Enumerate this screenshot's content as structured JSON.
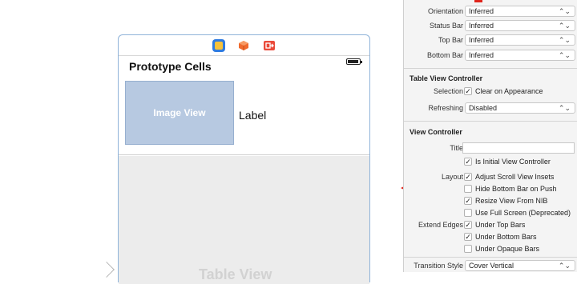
{
  "canvas": {
    "prototype_cells_title": "Prototype Cells",
    "image_view_label": "Image View",
    "cell_label": "Label",
    "table_view_ghost": "Table View",
    "dock_icons": [
      "view-controller-icon",
      "first-responder-icon",
      "exit-icon"
    ]
  },
  "inspector": {
    "simulated_metrics": {
      "rows": [
        {
          "label": "Orientation",
          "value": "Inferred"
        },
        {
          "label": "Status Bar",
          "value": "Inferred"
        },
        {
          "label": "Top Bar",
          "value": "Inferred"
        },
        {
          "label": "Bottom Bar",
          "value": "Inferred"
        }
      ]
    },
    "table_view_controller": {
      "heading": "Table View Controller",
      "selection_label": "Selection",
      "selection_option": "Clear on Appearance",
      "selection_checked": true,
      "refreshing_label": "Refreshing",
      "refreshing_value": "Disabled"
    },
    "view_controller": {
      "heading": "View Controller",
      "title_label": "Title",
      "title_value": "",
      "is_initial_label": "Is Initial View Controller",
      "is_initial_checked": true,
      "layout_label": "Layout",
      "layout_options": [
        {
          "label": "Adjust Scroll View Insets",
          "checked": true
        },
        {
          "label": "Hide Bottom Bar on Push",
          "checked": false
        },
        {
          "label": "Resize View From NIB",
          "checked": true
        },
        {
          "label": "Use Full Screen (Deprecated)",
          "checked": false
        }
      ],
      "extend_edges_label": "Extend Edges",
      "extend_edges_options": [
        {
          "label": "Under Top Bars",
          "checked": true
        },
        {
          "label": "Under Bottom Bars",
          "checked": true
        },
        {
          "label": "Under Opaque Bars",
          "checked": false
        }
      ],
      "transition_style_label": "Transition Style",
      "transition_style_value": "Cover Vertical"
    },
    "popup_chevron": "⌃⌄",
    "check_glyph": "✓"
  },
  "colors": {
    "arrow": "#e0241b",
    "image_view_fill": "#b7c9e1",
    "scene_border": "#8fb3d9"
  }
}
